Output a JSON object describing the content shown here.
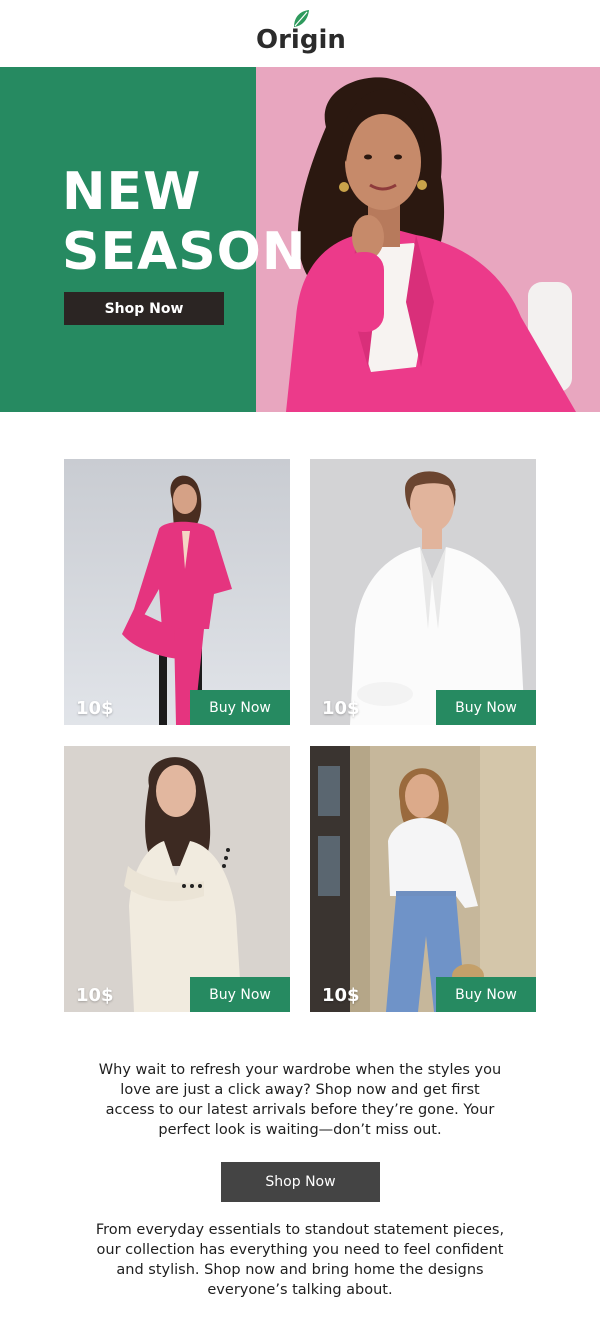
{
  "brand": {
    "name": "Origin",
    "leaf_color": "#2e9a5d",
    "text_color": "#2b2b2b"
  },
  "hero": {
    "title_line1": "NEW",
    "title_line2": "SEASON",
    "button_label": "Shop Now",
    "left_bg": "#268a61",
    "right_bg": "#e8a6bf"
  },
  "products": [
    {
      "price": "10$",
      "button_label": "Buy Now",
      "outfit": "pink suit"
    },
    {
      "price": "10$",
      "button_label": "Buy Now",
      "outfit": "white blazer"
    },
    {
      "price": "10$",
      "button_label": "Buy Now",
      "outfit": "cream suit"
    },
    {
      "price": "10$",
      "button_label": "Buy Now",
      "outfit": "white blouse and blue trousers"
    }
  ],
  "body": {
    "paragraph1": "Why wait to refresh your wardrobe when the styles you love are just a click away? Shop now and get first access to our latest arrivals before they’re gone. Your perfect look is waiting—don’t miss out.",
    "cta_label": "Shop Now",
    "paragraph2": "From everyday essentials to standout statement pieces, our collection has everything you need to feel confident and stylish. Shop now and bring home the designs everyone’s talking about."
  },
  "colors": {
    "accent_green": "#268a61",
    "dark_button": "#2b2523",
    "cta_gray": "#444444"
  }
}
